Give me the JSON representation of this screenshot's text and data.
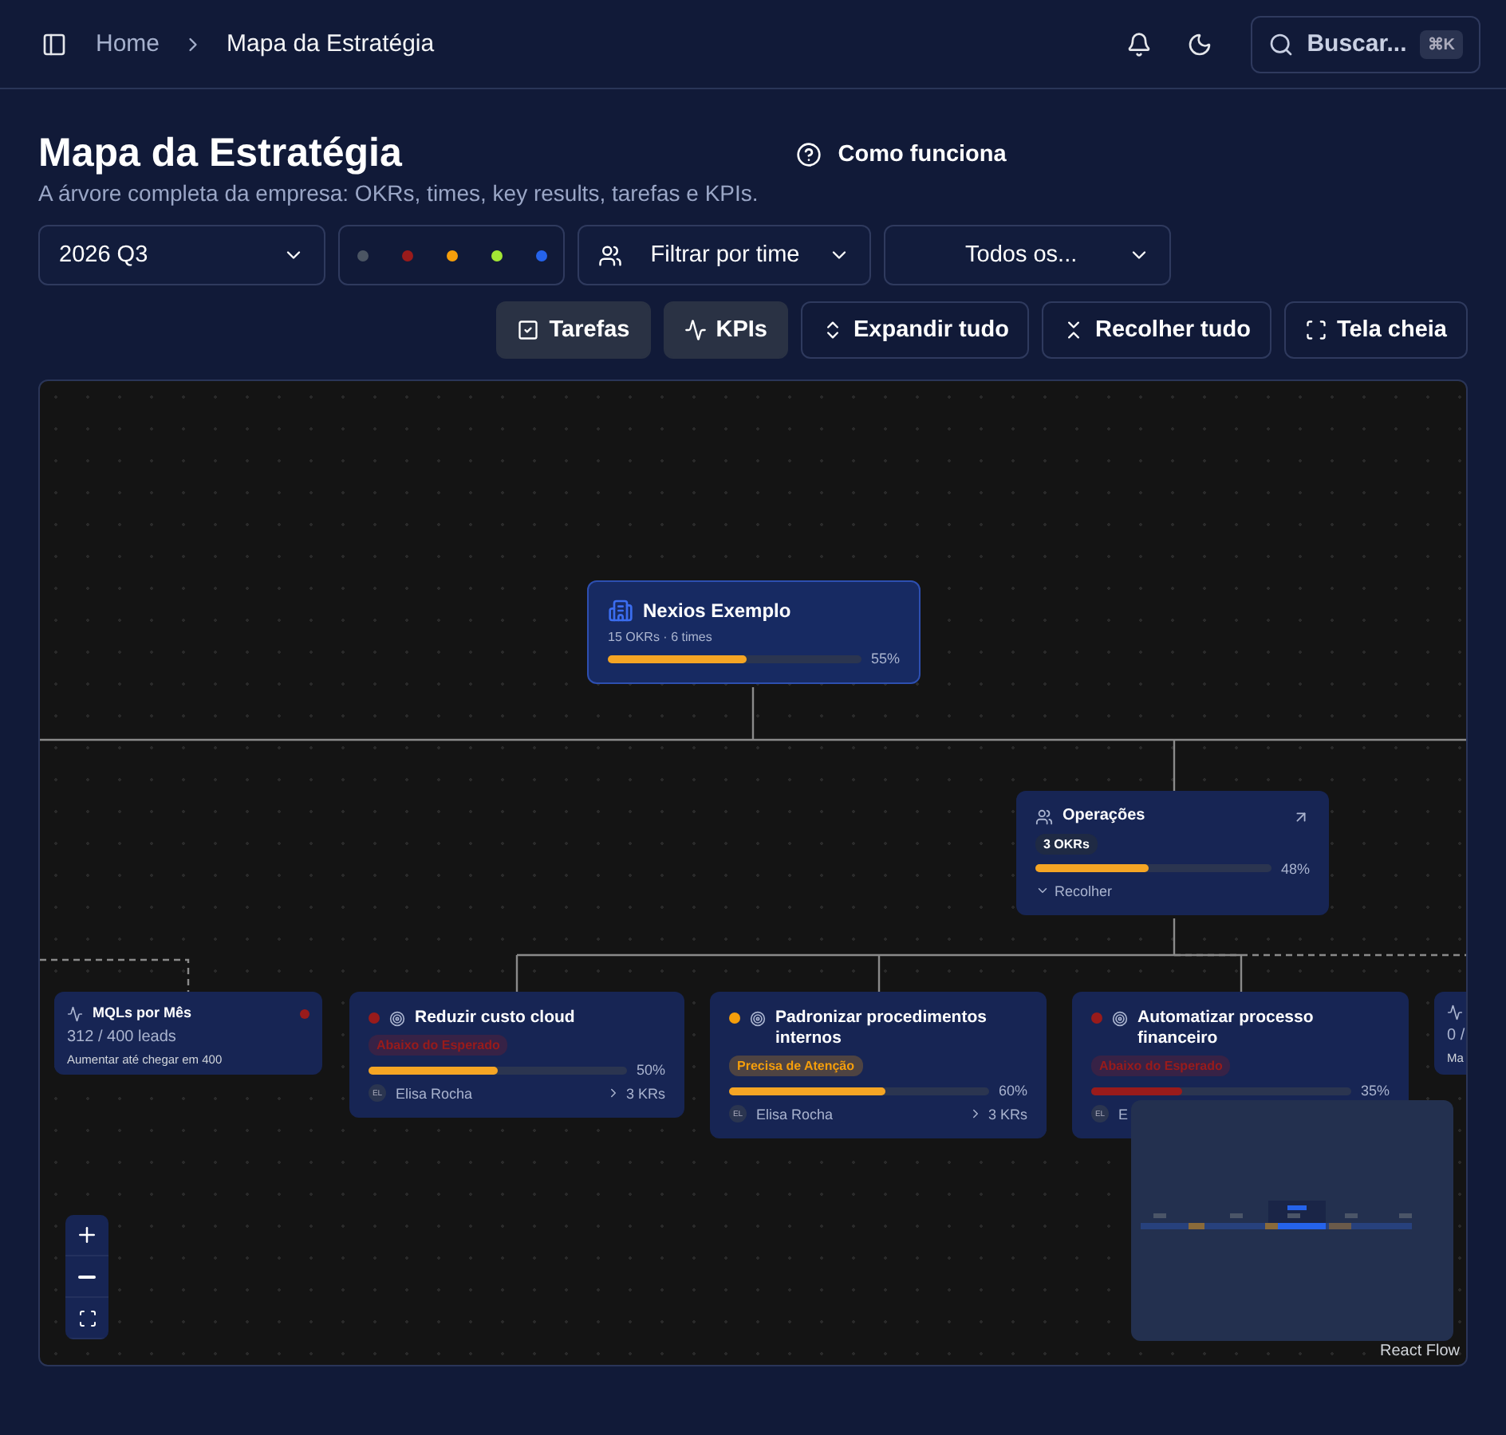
{
  "breadcrumb": [
    "Home",
    "Mapa da Estratégia"
  ],
  "search": {
    "placeholder": "Buscar...",
    "shortcut": "⌘K"
  },
  "page": {
    "title": "Mapa da Estratégia",
    "subtitle": "A árvore completa da empresa: OKRs, times, key results, tarefas e KPIs.",
    "help": "Como funciona"
  },
  "filters": {
    "period": "2026 Q3",
    "status_dots": [
      {
        "color": "#4b5563"
      },
      {
        "color": "#991b1b"
      },
      {
        "color": "#f59e0b"
      },
      {
        "color": "#a3e635"
      },
      {
        "color": "#2563eb"
      }
    ],
    "team": "Filtrar por time",
    "owner": "Todos os..."
  },
  "toolbar": [
    {
      "kind": "toggle",
      "label": "Tarefas",
      "selected": true
    },
    {
      "kind": "toggle",
      "label": "KPIs",
      "selected": true
    },
    {
      "kind": "action",
      "label": "Expandir tudo"
    },
    {
      "kind": "action",
      "label": "Recolher tudo"
    },
    {
      "kind": "action",
      "label": "Tela cheia"
    }
  ],
  "nodes": [
    {
      "kind": "company",
      "title": "Nexios Exemplo",
      "meta": "15 OKRs · 6 times",
      "level": 0.55,
      "reading": "55%"
    },
    {
      "kind": "team",
      "title": "Operações",
      "badge": "3 OKRs",
      "level": 0.48,
      "reading": "48%",
      "toggle": "Recolher"
    },
    {
      "kind": "kpi",
      "title": "MQLs por Mês",
      "value": "312 / 400 leads",
      "note": "Aumentar até chegar em 400",
      "color": "#991b1b"
    },
    {
      "kind": "okr",
      "title": "Reduzir custo cloud",
      "badge": "Abaixo do Esperado",
      "color": "#991b1b",
      "level": 0.5,
      "reading": "50%",
      "initials": "EL",
      "owner": "Elisa Rocha",
      "krs": "3 KRs"
    },
    {
      "kind": "okr",
      "title": "Padronizar procedimentos internos",
      "badge": "Precisa de Atenção",
      "color": "#f59e0b",
      "level": 0.6,
      "reading": "60%",
      "initials": "EL",
      "owner": "Elisa Rocha",
      "krs": "3 KRs"
    },
    {
      "kind": "okr",
      "title": "Automatizar processo financeiro",
      "badge": "Abaixo do Esperado",
      "color": "#991b1b",
      "level": 0.35,
      "reading": "35%",
      "initials": "EL",
      "owner": "E"
    },
    {
      "kind": "kpi",
      "value": "0 /",
      "note": "Ma"
    }
  ],
  "attribution": "React Flow"
}
